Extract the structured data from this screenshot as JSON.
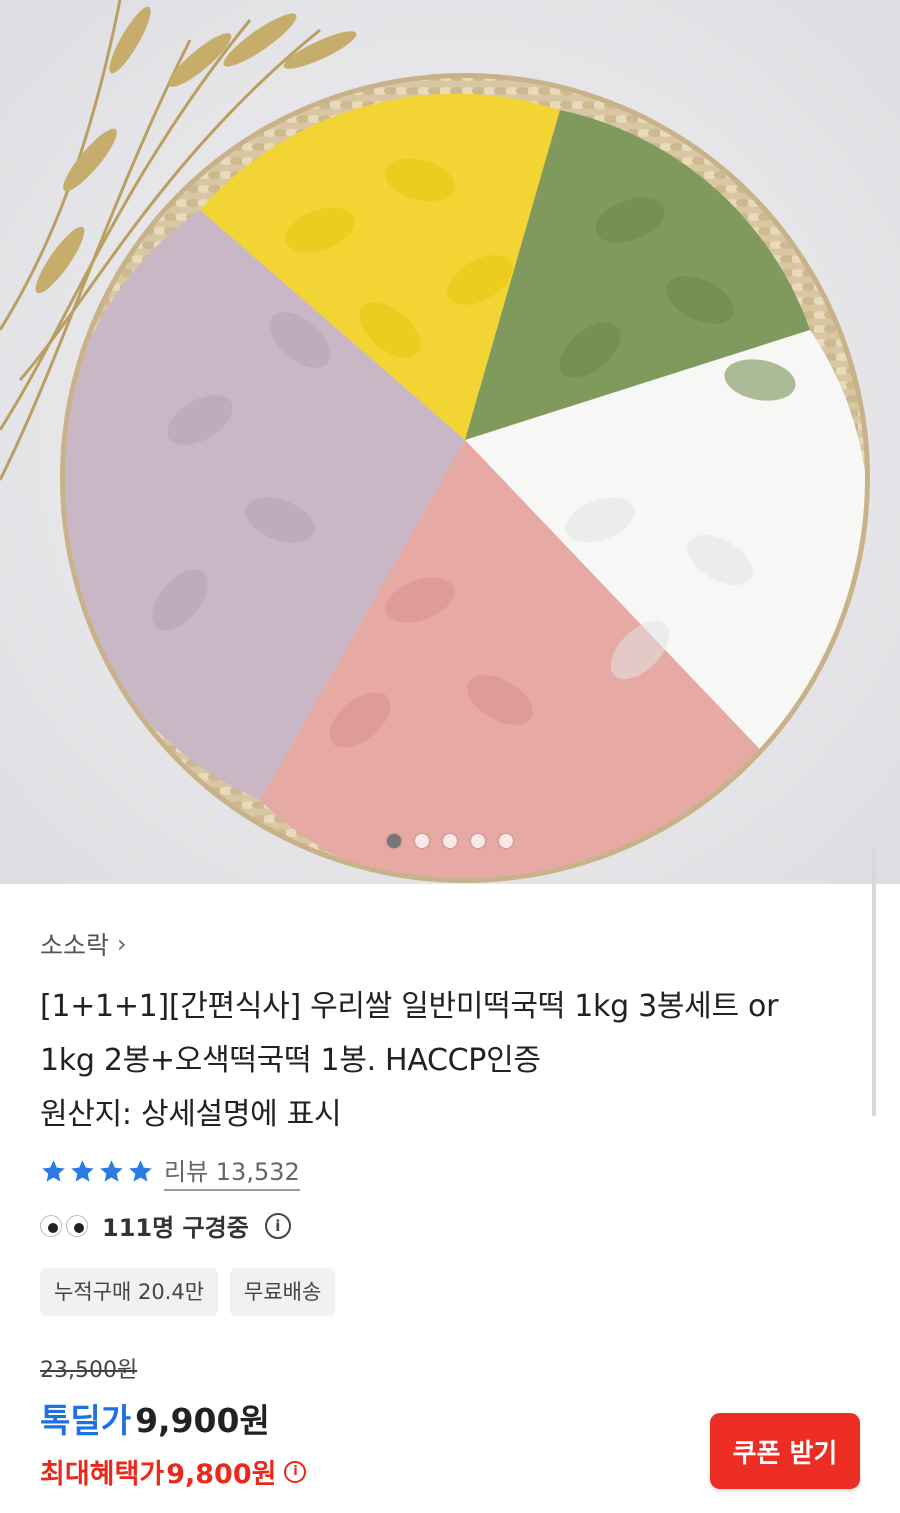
{
  "product": {
    "brand": "소소락",
    "title_lines": [
      "[1+1+1][간편식사] 우리쌀 일반미떡국떡 1kg 3봉세트 or",
      "1kg 2봉+오색떡국떡 1봉. HACCP인증",
      "원산지: 상세설명에 표시"
    ],
    "rating_stars": 4,
    "review_text": "리뷰 13,532",
    "watching_text": "111명 구경중",
    "tags": [
      "누적구매 20.4만",
      "무료배송"
    ],
    "original_price": "23,500원",
    "deal_label": "톡딜가",
    "deal_price": "9,900원",
    "max_benefit_label": "최대혜택가",
    "max_benefit_price": "9,800원",
    "coupon_button": "쿠폰 받기"
  },
  "carousel": {
    "count": 5,
    "active": 0
  },
  "colors": {
    "accent_blue": "#1f6fe5",
    "accent_red": "#e8291b",
    "coupon_bg": "#ec2d24",
    "star": "#2a7be4"
  },
  "icons": [
    "chevron-right-icon",
    "star-icon",
    "eyes-icon",
    "info-icon"
  ]
}
